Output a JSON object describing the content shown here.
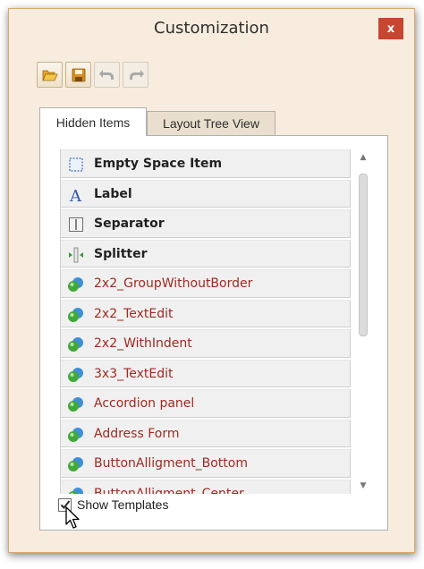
{
  "window": {
    "title": "Customization",
    "close_label": "x"
  },
  "toolbar": {
    "buttons": [
      {
        "icon": "open-folder-icon",
        "enabled": true
      },
      {
        "icon": "save-icon",
        "enabled": true
      },
      {
        "icon": "undo-icon",
        "enabled": false
      },
      {
        "icon": "redo-icon",
        "enabled": false
      }
    ]
  },
  "tabs": [
    {
      "label": "Hidden Items",
      "active": true
    },
    {
      "label": "Layout Tree View",
      "active": false
    }
  ],
  "list": {
    "items": [
      {
        "label": "Empty Space Item",
        "kind": "builtin",
        "icon": "empty-space-icon"
      },
      {
        "label": "Label",
        "kind": "builtin",
        "icon": "label-icon"
      },
      {
        "label": "Separator",
        "kind": "builtin",
        "icon": "separator-icon"
      },
      {
        "label": "Splitter",
        "kind": "builtin",
        "icon": "splitter-icon"
      },
      {
        "label": "2x2_GroupWithoutBorder",
        "kind": "template",
        "icon": "template-icon"
      },
      {
        "label": "2x2_TextEdit",
        "kind": "template",
        "icon": "template-icon"
      },
      {
        "label": "2x2_WithIndent",
        "kind": "template",
        "icon": "template-icon"
      },
      {
        "label": "3x3_TextEdit",
        "kind": "template",
        "icon": "template-icon"
      },
      {
        "label": "Accordion panel",
        "kind": "template",
        "icon": "template-icon"
      },
      {
        "label": "Address Form",
        "kind": "template",
        "icon": "template-icon"
      },
      {
        "label": "ButtonAlligment_Bottom",
        "kind": "template",
        "icon": "template-icon"
      },
      {
        "label": "ButtonAlligment_Center",
        "kind": "template",
        "icon": "template-icon"
      }
    ]
  },
  "show_templates": {
    "label": "Show Templates",
    "checked": true
  },
  "colors": {
    "window_bg": "#f7ecdd",
    "accent_border": "#d9a86a",
    "close_button": "#c64632",
    "template_text": "#a02a22"
  }
}
